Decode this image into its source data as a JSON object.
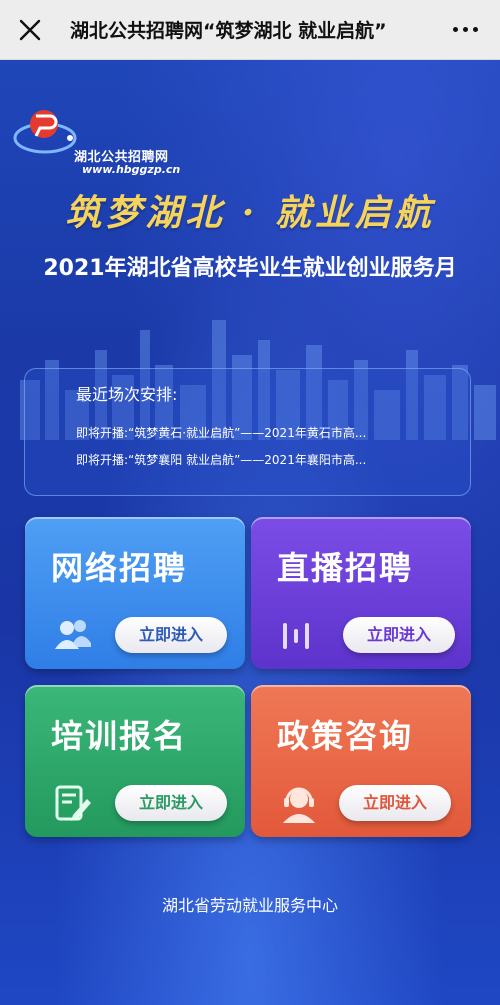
{
  "topbar": {
    "title": "湖北公共招聘网“筑梦湖北 就业启航”",
    "close_icon": "close-icon",
    "more_icon": "more-icon"
  },
  "logo": {
    "name": "湖北公共招聘网",
    "url": "www.hbggzp.cn"
  },
  "banner": {
    "slogan": "筑梦湖北 · 就业启航",
    "event_title": "2021年湖北省高校毕业生就业创业服务月"
  },
  "notice": {
    "heading": "最近场次安排:",
    "items": [
      "即将开播:“筑梦黄石·就业启航”——2021年黄石市高...",
      "即将开播:“筑梦襄阳 就业启航”——2021年襄阳市高..."
    ]
  },
  "cards": [
    {
      "title": "网络招聘",
      "button": "立即进入",
      "icon": "users-icon",
      "color": "#3a8bee"
    },
    {
      "title": "直播招聘",
      "button": "立即进入",
      "icon": "live-audio-icon",
      "color": "#6a3fd9"
    },
    {
      "title": "培训报名",
      "button": "立即进入",
      "icon": "edit-document-icon",
      "color": "#2ea86a"
    },
    {
      "title": "政策咨询",
      "button": "立即进入",
      "icon": "headset-support-icon",
      "color": "#e9663f"
    }
  ],
  "footer": {
    "text": "湖北省劳动就业服务中心"
  }
}
